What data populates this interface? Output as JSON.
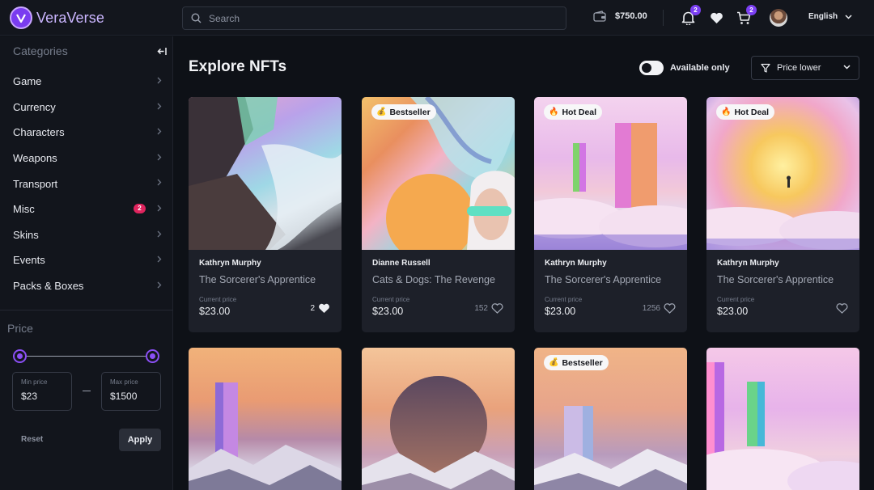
{
  "app": {
    "name": "VeraVerse"
  },
  "header": {
    "search_placeholder": "Search",
    "wallet_balance": "$750.00",
    "notifications_count": "2",
    "cart_count": "2",
    "language": "English"
  },
  "sidebar": {
    "categories_title": "Categories",
    "categories": [
      {
        "label": "Game"
      },
      {
        "label": "Currency"
      },
      {
        "label": "Characters"
      },
      {
        "label": "Weapons"
      },
      {
        "label": "Transport"
      },
      {
        "label": "Misc",
        "badge": "2"
      },
      {
        "label": "Skins"
      },
      {
        "label": "Events"
      },
      {
        "label": "Packs & Boxes"
      }
    ],
    "price": {
      "title": "Price",
      "min_label": "Min price",
      "min_value": "$23",
      "max_label": "Max price",
      "max_value": "$1500",
      "reset_label": "Reset",
      "apply_label": "Apply"
    }
  },
  "main": {
    "title": "Explore NFTs",
    "available_only_label": "Available only",
    "available_only_on": true,
    "sort_label": "Price lower",
    "price_caption": "Current price",
    "cards": [
      {
        "author": "Kathryn Murphy",
        "title": "The Sorcerer's Apprentice",
        "price": "$23.00",
        "likes": "2",
        "liked": true,
        "tag": ""
      },
      {
        "author": "Dianne Russell",
        "title": "Cats & Dogs: The Revenge",
        "price": "$23.00",
        "likes": "152",
        "liked": false,
        "tag": "Bestseller",
        "tag_emoji": "💰"
      },
      {
        "author": "Kathryn Murphy",
        "title": "The Sorcerer's Apprentice",
        "price": "$23.00",
        "likes": "1256",
        "liked": false,
        "tag": "Hot Deal",
        "tag_emoji": "🔥"
      },
      {
        "author": "Kathryn Murphy",
        "title": "The Sorcerer's Apprentice",
        "price": "$23.00",
        "likes": "",
        "liked": false,
        "tag": "Hot Deal",
        "tag_emoji": "🔥"
      },
      {
        "tag": ""
      },
      {
        "tag": ""
      },
      {
        "tag": "Bestseller",
        "tag_emoji": "💰"
      },
      {
        "tag": ""
      }
    ]
  },
  "colors": {
    "accent": "#7b3ff2",
    "background": "#0e1117",
    "card": "#1d2029",
    "badge_red": "#e0245e"
  }
}
